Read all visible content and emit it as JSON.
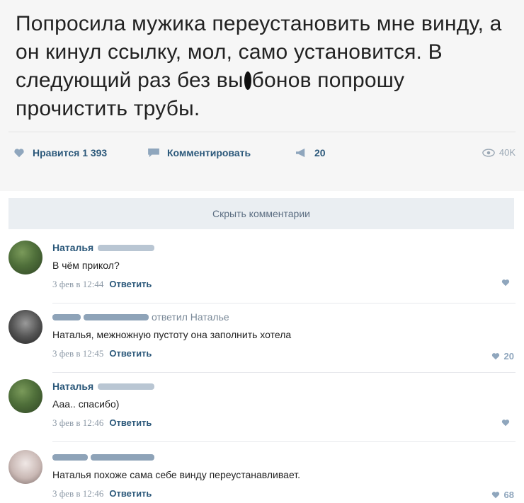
{
  "post": {
    "text_before": "Попросила мужика переустановить мне винду, а он кинул ссылку, мол, само установится. В следующий раз без вы",
    "text_after": "бонов попрошу прочистить трубы."
  },
  "actions": {
    "like_label": "Нравится",
    "like_count": "1 393",
    "comment_label": "Комментировать",
    "share_count": "20",
    "views": "40K"
  },
  "hide_comments_label": "Скрыть комментарии",
  "comments": [
    {
      "author": "Наталья",
      "text": "В чём прикол?",
      "date": "3 фев в 12:44",
      "reply_label": "Ответить",
      "likes": ""
    },
    {
      "author": "",
      "reply_to": "ответил Наталье",
      "text": "Наталья, межножную пустоту она заполнить хотела",
      "date": "3 фев в 12:45",
      "reply_label": "Ответить",
      "likes": "20"
    },
    {
      "author": "Наталья",
      "text": "Ааа.. спасибо)",
      "date": "3 фев в 12:46",
      "reply_label": "Ответить",
      "likes": ""
    },
    {
      "author": "",
      "text": "Наталья похоже сама себе винду переустанавливает.",
      "date": "3 фев в 12:46",
      "reply_label": "Ответить",
      "likes": "68"
    }
  ],
  "colors": {
    "link": "#2b587a",
    "bar": "#eaeef2",
    "post_bg": "#f6f6f6"
  },
  "icons": [
    "heart-icon",
    "comment-icon",
    "megaphone-icon",
    "eye-icon",
    "avatar"
  ]
}
